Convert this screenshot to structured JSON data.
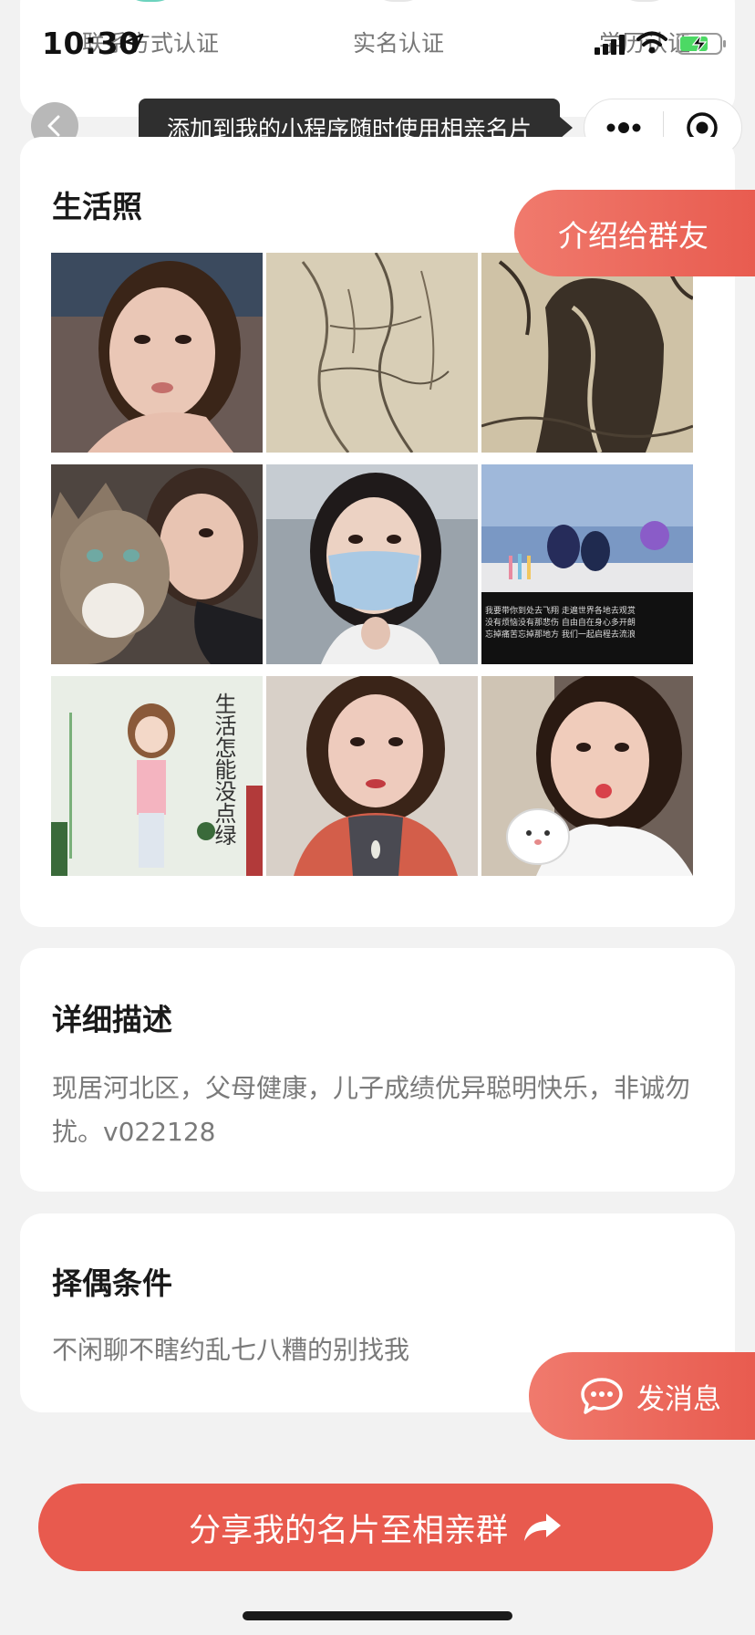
{
  "status_bar": {
    "time": "10:30"
  },
  "verification": {
    "items": [
      {
        "label": "联系方式认证",
        "verified": true
      },
      {
        "label": "实名认证",
        "verified": false
      },
      {
        "label": "学历认证",
        "verified": false
      }
    ]
  },
  "nav": {
    "tip": "添加到我的小程序随时使用相亲名片",
    "icons": [
      "back-icon",
      "more-icon",
      "close-target-icon"
    ]
  },
  "photos": {
    "title": "生活照",
    "items": [
      {
        "name": "selfie-woman-1"
      },
      {
        "name": "pencil-sketch-figure"
      },
      {
        "name": "ink-sketch-tree"
      },
      {
        "name": "selfie-with-cat"
      },
      {
        "name": "selfie-face-mask"
      },
      {
        "name": "lake-travel-photo",
        "caption_lines": [
          "我要带你到处去飞翔 走遍世界各地去观赏",
          "没有烦恼没有那悲伤 自由自在身心多开朗",
          "忘掉痛苦忘掉那地方 我们一起启程去流浪"
        ]
      },
      {
        "name": "height-chart-photo",
        "wall_text": "生活怎能没点绿"
      },
      {
        "name": "selfie-woman-2"
      },
      {
        "name": "selfie-pout-sticker"
      }
    ]
  },
  "intro_button": "介绍给群友",
  "description": {
    "title": "详细描述",
    "text": "现居河北区，父母健康，儿子成绩优异聪明快乐，非诚勿扰。v022128"
  },
  "conditions": {
    "title": "择偶条件",
    "text": "不闲聊不瞎约乱七八糟的别找我"
  },
  "message_button": "发消息",
  "share_button": "分享我的名片至相亲群",
  "colors": {
    "accent": "#e85a4e",
    "verified": "#6dd3be",
    "page_bg": "#f2f2f2"
  }
}
